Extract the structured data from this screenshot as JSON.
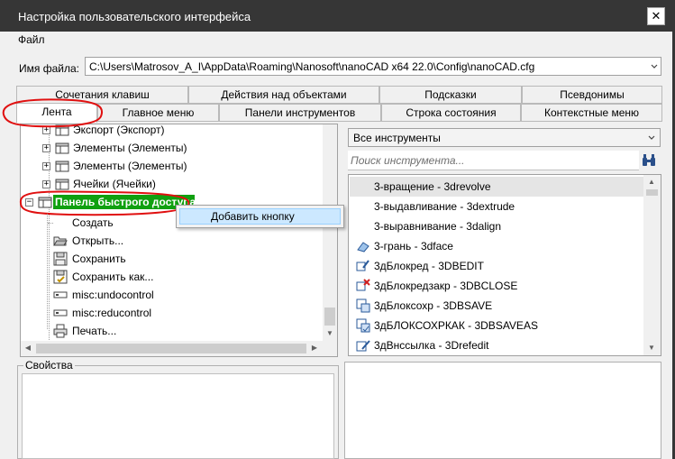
{
  "window": {
    "title": "Настройка пользовательского интерфейса"
  },
  "menubar": {
    "file": "Файл"
  },
  "file": {
    "label": "Имя файла:",
    "path": "C:\\Users\\Matrosov_A_I\\AppData\\Roaming\\Nanosoft\\nanoCAD x64 22.0\\Config\\nanoCAD.cfg"
  },
  "tabs_row1": [
    "Сочетания клавиш",
    "Действия над объектами",
    "Подсказки",
    "Псевдонимы"
  ],
  "tabs_row2": [
    "Лента",
    "Главное меню",
    "Панели инструментов",
    "Строка состояния",
    "Контекстные меню"
  ],
  "active_tab": "Лента",
  "tree": {
    "items": [
      {
        "label": "Экспорт (Экспорт)"
      },
      {
        "label": "Элементы (Элементы)"
      },
      {
        "label": "Элементы (Элементы)"
      },
      {
        "label": "Ячейки (Ячейки)"
      },
      {
        "label": "Панель быстрого доступа"
      },
      {
        "label": "Создать"
      },
      {
        "label": "Открыть..."
      },
      {
        "label": "Сохранить"
      },
      {
        "label": "Сохранить как..."
      },
      {
        "label": "misc:undocontrol"
      },
      {
        "label": "misc:reducontrol"
      },
      {
        "label": "Печать..."
      }
    ]
  },
  "context_menu": {
    "add_button": "Добавить кнопку"
  },
  "tools": {
    "filter": "Все инструменты",
    "search_placeholder": "Поиск инструмента...",
    "items": [
      {
        "label": "3-вращение - 3drevolve"
      },
      {
        "label": "3-выдавливание - 3dextrude"
      },
      {
        "label": "3-выравнивание - 3dalign"
      },
      {
        "label": "3-грань - 3dface"
      },
      {
        "label": "3дБлокред - 3DBEDIT"
      },
      {
        "label": "3дБлокредзакр - 3DBCLOSE"
      },
      {
        "label": "3дБлоксохр - 3DBSAVE"
      },
      {
        "label": "3дБЛОКСОХРКАК - 3DBSAVEAS"
      },
      {
        "label": "3дВнссылка - 3Drefedit"
      }
    ]
  },
  "properties": {
    "label": "Свойства"
  },
  "colors": {
    "highlight_green": "#10a010",
    "annotation_red": "#e01010",
    "menu_hover": "#cce8ff"
  }
}
